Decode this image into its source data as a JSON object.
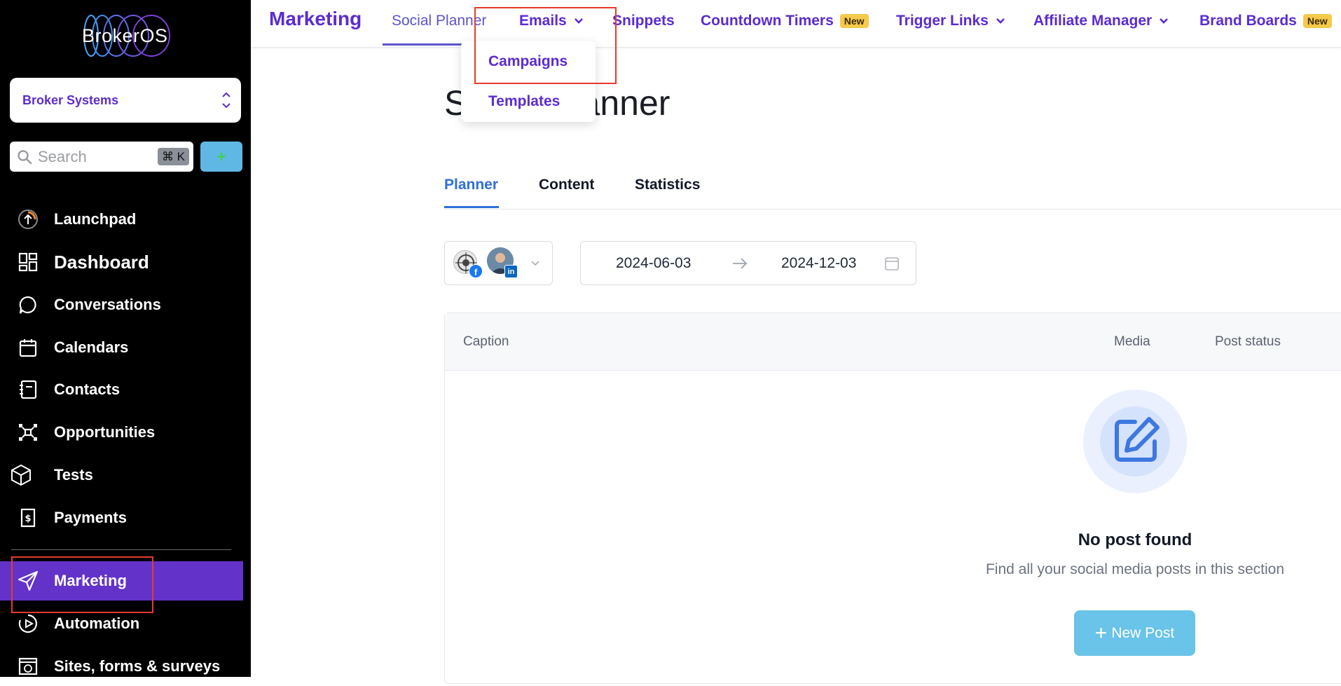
{
  "sidebar": {
    "logo_text": "BrokerOS",
    "account": "Broker Systems",
    "search": {
      "placeholder": "Search",
      "shortcut": "⌘ K"
    },
    "quick_add": "+",
    "items": [
      {
        "label": "Launchpad",
        "icon": "launchpad-icon"
      },
      {
        "label": "Dashboard",
        "icon": "dashboard-icon"
      },
      {
        "label": "Conversations",
        "icon": "chat-bubble-icon"
      },
      {
        "label": "Calendars",
        "icon": "calendar-icon"
      },
      {
        "label": "Contacts",
        "icon": "contacts-book-icon"
      },
      {
        "label": "Opportunities",
        "icon": "network-icon"
      },
      {
        "label": "Tests",
        "icon": "cube-icon"
      },
      {
        "label": "Payments",
        "icon": "receipt-dollar-icon"
      },
      {
        "label": "Marketing",
        "icon": "paper-plane-icon",
        "active": true
      },
      {
        "label": "Automation",
        "icon": "automation-icon"
      },
      {
        "label": "Sites, forms & surveys",
        "icon": "globe-window-icon"
      }
    ]
  },
  "topbar": {
    "title": "Marketing",
    "nav": [
      {
        "label": "Social Planner",
        "active": true
      },
      {
        "label": "Emails",
        "has_dropdown": true
      },
      {
        "label": "Snippets"
      },
      {
        "label": "Countdown Timers",
        "badge": "New"
      },
      {
        "label": "Trigger Links",
        "has_dropdown": true
      },
      {
        "label": "Affiliate Manager",
        "has_dropdown": true
      },
      {
        "label": "Brand Boards",
        "badge": "New"
      }
    ],
    "emails_dropdown": [
      "Campaigns",
      "Templates"
    ]
  },
  "main": {
    "heading": "Social Planner",
    "tabs": [
      "Planner",
      "Content",
      "Statistics"
    ],
    "active_tab": "Planner",
    "date_range": {
      "start": "2024-06-03",
      "end": "2024-12-03"
    },
    "table_headers": [
      "Caption",
      "Media",
      "Post status"
    ],
    "empty": {
      "title": "No post found",
      "subtitle": "Find all your social media posts in this section",
      "button": "New Post"
    }
  },
  "colors": {
    "brand_purple": "#5b2bd1",
    "active_nav_bg": "#6332c9",
    "tab_blue": "#2f6fd9",
    "new_badge": "#f6c94a",
    "primary_button": "#6ac3e8",
    "highlight_box": "#e53b2c"
  }
}
